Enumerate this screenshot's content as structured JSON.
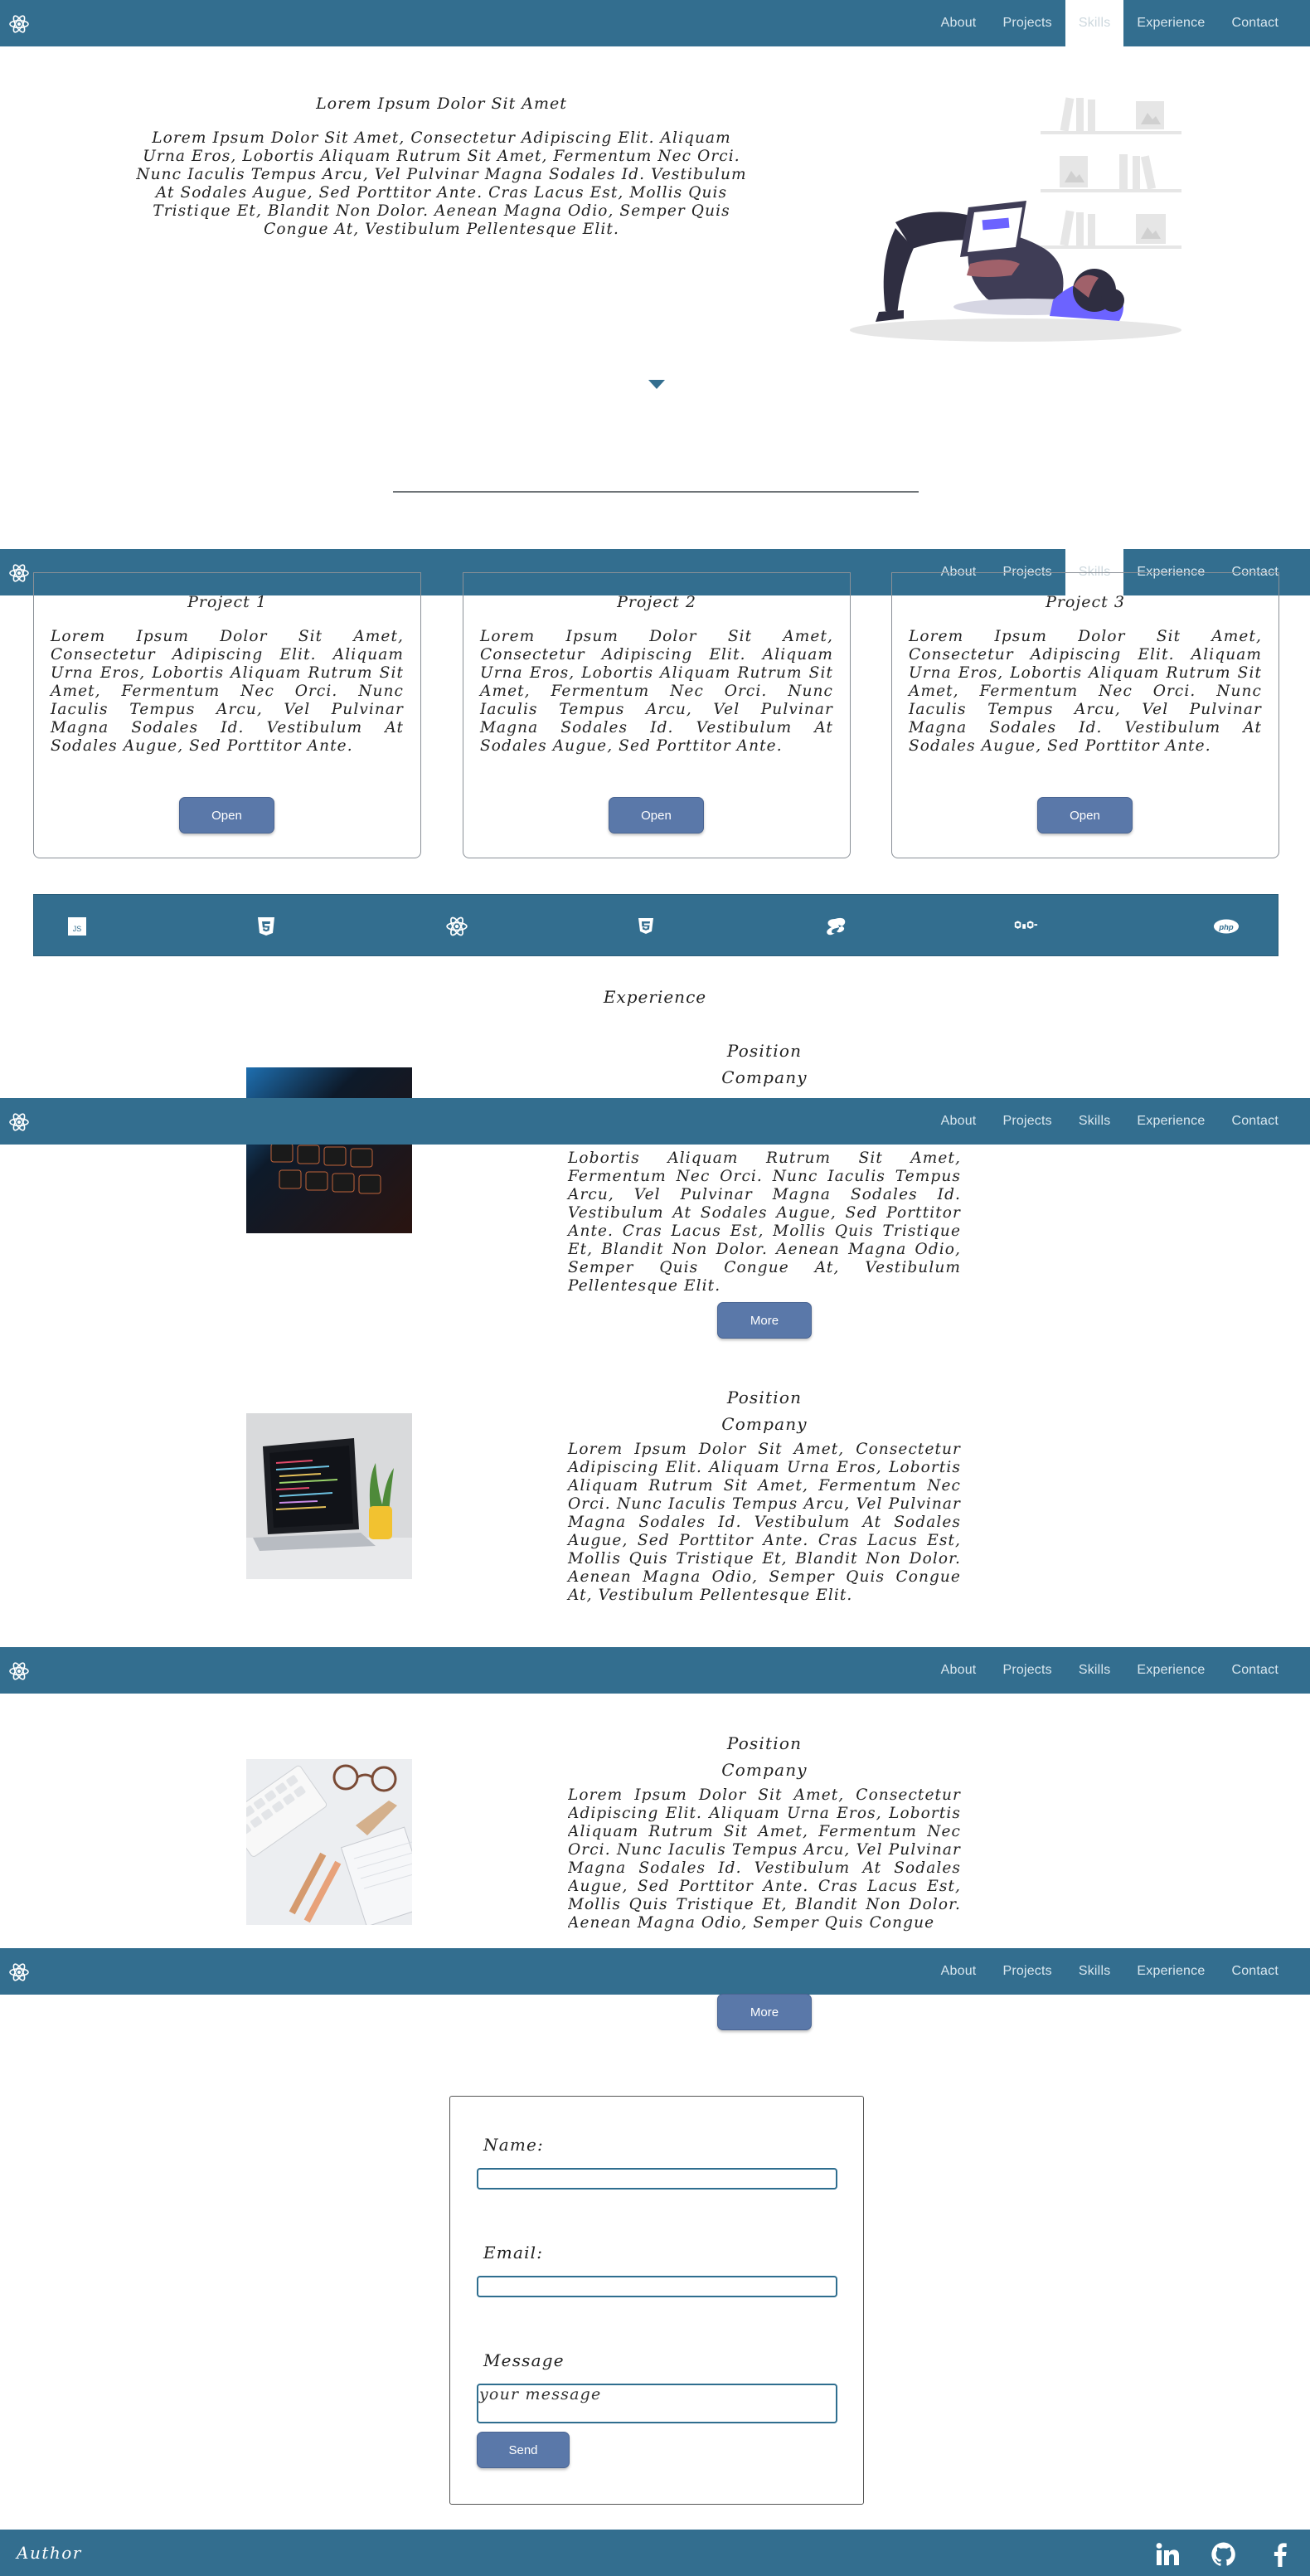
{
  "nav": {
    "items": [
      {
        "label": "About"
      },
      {
        "label": "Projects"
      },
      {
        "label": "Skills"
      },
      {
        "label": "Experience"
      },
      {
        "label": "Contact"
      }
    ],
    "active_first_two": "Skills",
    "logo_icon": "react-atom-icon"
  },
  "hero": {
    "title": "Lorem Ipsum Dolor Sit Amet",
    "text": "Lorem Ipsum Dolor Sit Amet, Consectetur Adipiscing Elit. Aliquam Urna Eros, Lobortis Aliquam Rutrum Sit Amet, Fermentum Nec Orci. Nunc Iaculis Tempus Arcu, Vel Pulvinar Magna Sodales Id. Vestibulum At Sodales Augue, Sed Porttitor Ante. Cras Lacus Est, Mollis Quis Tristique Et, Blandit Non Dolor. Aenean Magna Odio, Semper Quis Congue At, Vestibulum Pellentesque Elit."
  },
  "projects": [
    {
      "title": "Project 1",
      "text": "Lorem Ipsum Dolor Sit Amet, Consectetur Adipiscing Elit. Aliquam Urna Eros, Lobortis Aliquam Rutrum Sit Amet, Fermentum Nec Orci. Nunc Iaculis Tempus Arcu, Vel Pulvinar Magna Sodales Id. Vestibulum At Sodales Augue, Sed Porttitor Ante.",
      "button": "Open"
    },
    {
      "title": "Project 2",
      "text": "Lorem Ipsum Dolor Sit Amet, Consectetur Adipiscing Elit. Aliquam Urna Eros, Lobortis Aliquam Rutrum Sit Amet, Fermentum Nec Orci. Nunc Iaculis Tempus Arcu, Vel Pulvinar Magna Sodales Id. Vestibulum At Sodales Augue, Sed Porttitor Ante.",
      "button": "Open"
    },
    {
      "title": "Project 3",
      "text": "Lorem Ipsum Dolor Sit Amet, Consectetur Adipiscing Elit. Aliquam Urna Eros, Lobortis Aliquam Rutrum Sit Amet, Fermentum Nec Orci. Nunc Iaculis Tempus Arcu, Vel Pulvinar Magna Sodales Id. Vestibulum At Sodales Augue, Sed Porttitor Ante.",
      "button": "Open"
    }
  ],
  "skills": {
    "icons": [
      "javascript-icon",
      "html5-icon",
      "react-icon",
      "css3-icon",
      "sass-icon",
      "nodejs-icon",
      "php-icon"
    ],
    "js_text": "JS"
  },
  "experience": {
    "heading": "Experience",
    "items": [
      {
        "position": "Position",
        "company": "Company",
        "text_visible": "Lobortis Aliquam Rutrum Sit Amet, Fermentum Nec Orci. Nunc Iaculis Tempus Arcu, Vel Pulvinar Magna Sodales Id. Vestibulum At Sodales Augue, Sed Porttitor Ante. Cras Lacus Est, Mollis Quis Tristique Et, Blandit Non Dolor. Aenean Magna Odio, Semper Quis Congue At, Vestibulum Pellentesque Elit.",
        "button": "More",
        "image": "keyboard-photo"
      },
      {
        "position": "Position",
        "company": "Company",
        "text": "Lorem Ipsum Dolor Sit Amet, Consectetur Adipiscing Elit. Aliquam Urna Eros, Lobortis Aliquam Rutrum Sit Amet, Fermentum Nec Orci. Nunc Iaculis Tempus Arcu, Vel Pulvinar Magna Sodales Id. Vestibulum At Sodales Augue, Sed Porttitor Ante. Cras Lacus Est, Mollis Quis Tristique Et, Blandit Non Dolor. Aenean Magna Odio, Semper Quis Congue At, Vestibulum Pellentesque Elit.",
        "image": "laptop-photo"
      },
      {
        "position": "Position",
        "company": "Company",
        "text": "Lorem Ipsum Dolor Sit Amet, Consectetur Adipiscing Elit. Aliquam Urna Eros, Lobortis Aliquam Rutrum Sit Amet, Fermentum Nec Orci. Nunc Iaculis Tempus Arcu, Vel Pulvinar Magna Sodales Id. Vestibulum At Sodales Augue, Sed Porttitor Ante. Cras Lacus Est, Mollis Quis Tristique Et, Blandit Non Dolor. Aenean Magna Odio, Semper Quis Congue",
        "button": "More",
        "image": "desk-photo"
      }
    ]
  },
  "contact": {
    "name_label": "Name:",
    "email_label": "Email:",
    "message_label": "Message",
    "message_placeholder": "your message",
    "send_button": "Send"
  },
  "footer": {
    "author": "Author",
    "social_icons": [
      "linkedin-icon",
      "github-icon",
      "facebook-icon"
    ]
  },
  "colors": {
    "nav": "#336e8f",
    "button": "#5a78a9",
    "accent_illustration": "#6c63ff"
  }
}
